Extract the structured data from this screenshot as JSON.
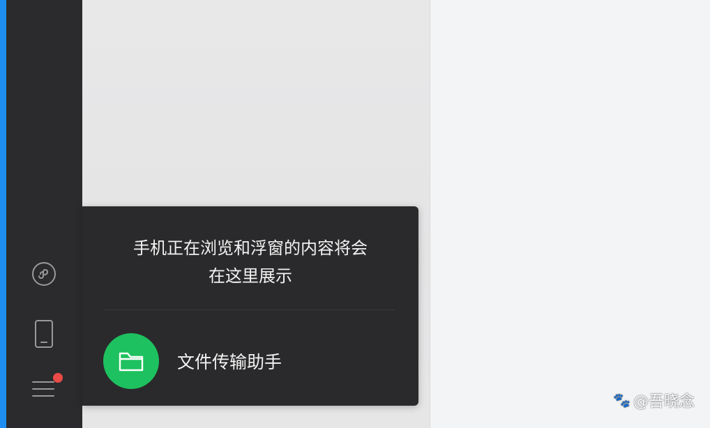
{
  "popup": {
    "message_line1": "手机正在浏览和浮窗的内容将会",
    "message_line2": "在这里展示",
    "file_transfer_label": "文件传输助手"
  },
  "sidebar": {
    "icons": [
      "mini-program-icon",
      "phone-icon",
      "menu-icon"
    ],
    "menu_has_notification": true
  },
  "watermark": {
    "text": "@吾晓念"
  },
  "colors": {
    "accent_bar": "#1e8ff0",
    "sidebar_bg": "#2b2b2d",
    "popup_bg": "#2a2a2c",
    "file_avatar": "#1ec15f",
    "notification_dot": "#e94b47"
  }
}
